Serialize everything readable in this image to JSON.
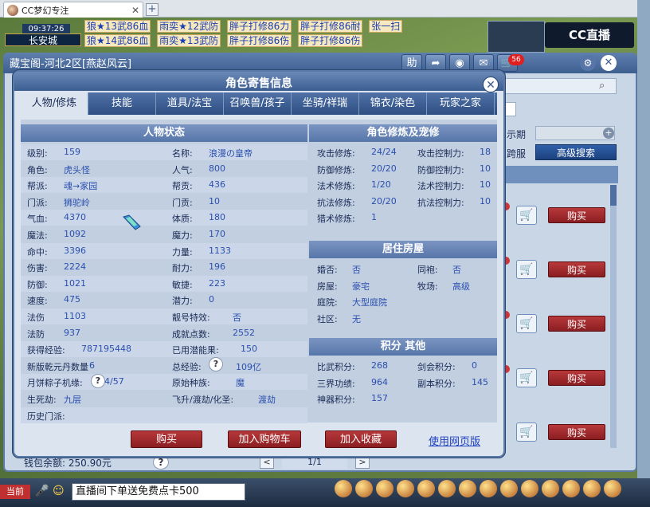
{
  "browser": {
    "tab_title": "CC梦幻专注",
    "tab_close": "✕",
    "new_tab": "+"
  },
  "hud": {
    "time": "09:37:26",
    "city": "长安城",
    "ticker_rows": [
      [
        "狼★13武86血",
        "雨奕★12武防",
        "胖子打修86力",
        "胖子打修86耐",
        "张一扫"
      ],
      [
        "狼★14武86血",
        "雨奕★13武防",
        "胖子打修86伤",
        "胖子打修86伤"
      ]
    ],
    "logo": "CC直播"
  },
  "cbg": {
    "title": "藏宝阁-河北2区[燕赵风云]",
    "help_btn": "助",
    "share_icon": "share-icon",
    "stop_icon": "stop-icon",
    "msg_badge": "56",
    "cart_icon": "cart-icon",
    "gear_icon": "gear-icon",
    "close_label": "✕",
    "sale_label": "示期",
    "cross_label": "跨服",
    "advanced_search": "高级搜索",
    "buy_label": "购买",
    "wallet": "钱包余额: 250.90元",
    "help_label": "?",
    "prev_label": "<",
    "next_label": ">",
    "page": "1/1"
  },
  "dialog": {
    "title": "角色寄售信息",
    "close_label": "✕",
    "tabs": [
      "人物/修炼",
      "技能",
      "道具/法宝",
      "召唤兽/孩子",
      "坐骑/祥瑞",
      "锦衣/染色",
      "玩家之家"
    ],
    "active_tab": 0,
    "status": {
      "header": "人物状态",
      "left": [
        {
          "k": "级别:",
          "v": "159"
        },
        {
          "k": "角色:",
          "v": "虎头怪"
        },
        {
          "k": "帮派:",
          "v": "魂→家园"
        },
        {
          "k": "门派:",
          "v": "狮驼岭"
        },
        {
          "k": "气血:",
          "v": "4370"
        },
        {
          "k": "魔法:",
          "v": "1092"
        },
        {
          "k": "命中:",
          "v": "3396"
        },
        {
          "k": "伤害:",
          "v": "2224"
        },
        {
          "k": "防御:",
          "v": "1021"
        },
        {
          "k": "速度:",
          "v": "475"
        },
        {
          "k": "法伤",
          "v": "1103"
        },
        {
          "k": "法防",
          "v": "937"
        },
        {
          "k": "获得经验:",
          "v": "787195448"
        },
        {
          "k": "新版乾元丹数量",
          "v": "6"
        },
        {
          "k": "月饼粽子机缘:",
          "v": "14/57"
        },
        {
          "k": "生死劫:",
          "v": "九层"
        },
        {
          "k": "历史门派:",
          "v": ""
        }
      ],
      "right": [
        {
          "k": "名称:",
          "v": "浪漫の皇帝"
        },
        {
          "k": "人气:",
          "v": "800"
        },
        {
          "k": "帮贡:",
          "v": "436"
        },
        {
          "k": "门贡:",
          "v": "10"
        },
        {
          "k": "体质:",
          "v": "180"
        },
        {
          "k": "魔力:",
          "v": "170"
        },
        {
          "k": "力量:",
          "v": "1133"
        },
        {
          "k": "耐力:",
          "v": "196"
        },
        {
          "k": "敏捷:",
          "v": "223"
        },
        {
          "k": "潜力:",
          "v": "0"
        },
        {
          "k": "靓号特效:",
          "v": "否"
        },
        {
          "k": "成就点数:",
          "v": "2552"
        },
        {
          "k": "已用潜能果:",
          "v": "150"
        },
        {
          "k": "总经验:",
          "v": "109亿"
        },
        {
          "k": "原始种族:",
          "v": "魔"
        },
        {
          "k": "飞升/渡劫/化圣:",
          "v": "渡劫"
        }
      ]
    },
    "cultivation": {
      "header": "角色修炼及宠修",
      "rows": [
        {
          "k1": "攻击修炼:",
          "v1": "24/24",
          "k2": "攻击控制力:",
          "v2": "18"
        },
        {
          "k1": "防御修炼:",
          "v1": "20/20",
          "k2": "防御控制力:",
          "v2": "10"
        },
        {
          "k1": "法术修炼:",
          "v1": "1/20",
          "k2": "法术控制力:",
          "v2": "10"
        },
        {
          "k1": "抗法修炼:",
          "v1": "20/20",
          "k2": "抗法控制力:",
          "v2": "10"
        },
        {
          "k1": "猎术修炼:",
          "v1": "1",
          "k2": "",
          "v2": ""
        }
      ]
    },
    "house": {
      "header": "居住房屋",
      "rows": [
        {
          "k1": "婚否:",
          "v1": "否",
          "k2": "同袍:",
          "v2": "否"
        },
        {
          "k1": "房屋:",
          "v1": "豪宅",
          "k2": "牧场:",
          "v2": "高级"
        },
        {
          "k1": "庭院:",
          "v1": "大型庭院",
          "k2": "",
          "v2": ""
        },
        {
          "k1": "社区:",
          "v1": "无",
          "k2": "",
          "v2": ""
        }
      ]
    },
    "points": {
      "header": "积分 其他",
      "rows": [
        {
          "k1": "比武积分:",
          "v1": "268",
          "k2": "剑会积分:",
          "v2": "0"
        },
        {
          "k1": "三界功绩:",
          "v1": "964",
          "k2": "副本积分:",
          "v2": "145"
        },
        {
          "k1": "神器积分:",
          "v1": "157",
          "k2": "",
          "v2": ""
        }
      ]
    },
    "buttons": {
      "buy": "购买",
      "add_cart": "加入购物车",
      "add_fav": "加入收藏",
      "web": "使用网页版"
    },
    "help_label": "?"
  },
  "taskbar": {
    "current": "当前",
    "chat": "直播间下单送免费点卡500"
  },
  "colors": {
    "accent": "#3c5e91",
    "buy_red": "#a42a2d",
    "value_blue": "#2a4fae"
  }
}
